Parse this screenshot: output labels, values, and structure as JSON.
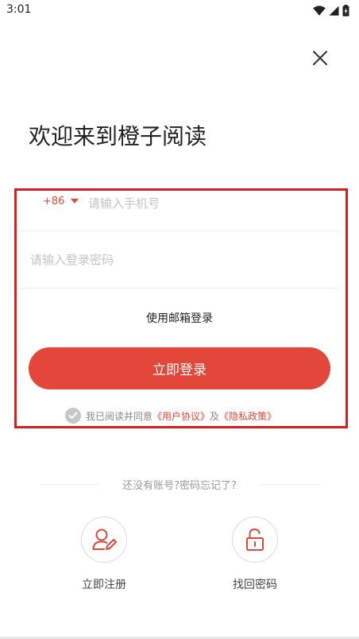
{
  "status_bar": {
    "time": "3:01",
    "icons": [
      "wifi-icon",
      "signal-icon",
      "battery-icon"
    ]
  },
  "header": {
    "close_icon": "close-icon"
  },
  "title": "欢迎来到橙子阅读",
  "form": {
    "country_code": "+86",
    "phone_placeholder": "请输入手机号",
    "password_placeholder": "请输入登录密码",
    "email_login": "使用邮箱登录",
    "login_button": "立即登录"
  },
  "agreement": {
    "prefix": "我已阅读并同意",
    "user_agreement": "《用户协议》",
    "and": "及",
    "privacy_policy": "《隐私政策》",
    "checked": true
  },
  "help_text": "还没有账号?密码忘记了?",
  "actions": [
    {
      "label": "立即注册",
      "icon": "user-edit-icon"
    },
    {
      "label": "找回密码",
      "icon": "unlock-icon"
    }
  ],
  "colors": {
    "accent": "#e2473a",
    "highlight": "#d81e1e",
    "muted": "#999999"
  }
}
